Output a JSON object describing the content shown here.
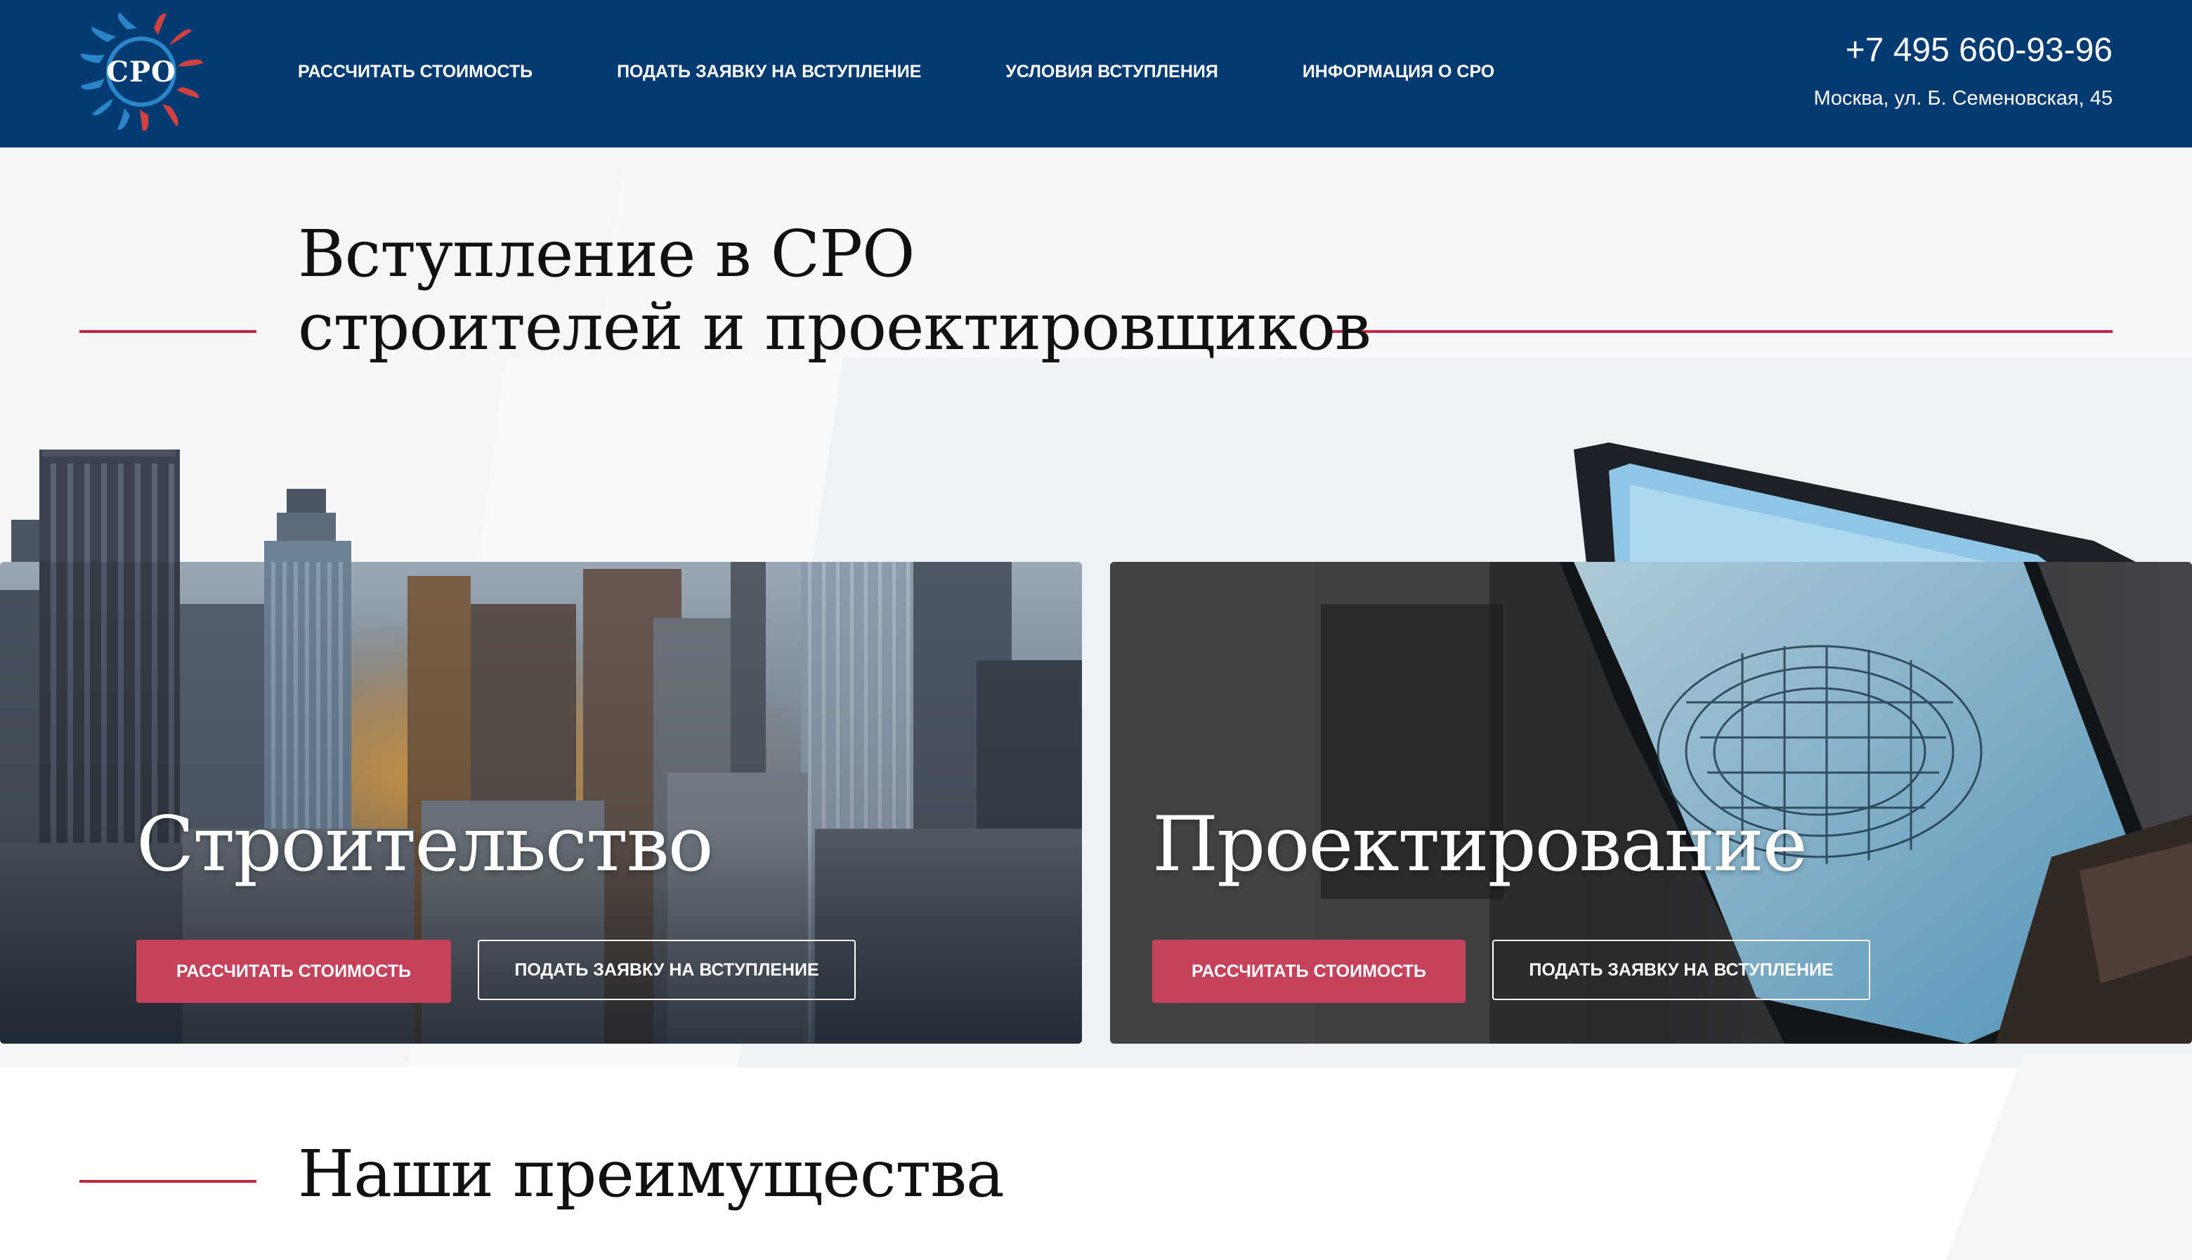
{
  "header": {
    "logo_text": "СРО",
    "nav": [
      {
        "label": "РАССЧИТАТЬ СТОИМОСТЬ"
      },
      {
        "label": "ПОДАТЬ ЗАЯВКУ НА ВСТУПЛЕНИЕ"
      },
      {
        "label": "УСЛОВИЯ ВСТУПЛЕНИЯ"
      },
      {
        "label": "ИНФОРМАЦИЯ О СРО"
      }
    ],
    "phone": "+7 495 660-93-96",
    "address": "Москва, ул. Б. Семеновская, 45"
  },
  "hero": {
    "title_line1": "Вступление в СРО",
    "title_line2": "строителей и проектировщиков"
  },
  "cards": [
    {
      "title": "Строительство",
      "primary_button": "РАССЧИТАТЬ СТОИМОСТЬ",
      "secondary_button": "ПОДАТЬ ЗАЯВКУ НА ВСТУПЛЕНИЕ"
    },
    {
      "title": "Проектирование",
      "primary_button": "РАССЧИТАТЬ СТОИМОСТЬ",
      "secondary_button": "ПОДАТЬ ЗАЯВКУ НА ВСТУПЛЕНИЕ"
    }
  ],
  "advantages": {
    "title": "Наши преимущества"
  },
  "colors": {
    "header_bg": "#053a72",
    "accent_red": "#c4283f",
    "button_red": "#c5425a"
  }
}
